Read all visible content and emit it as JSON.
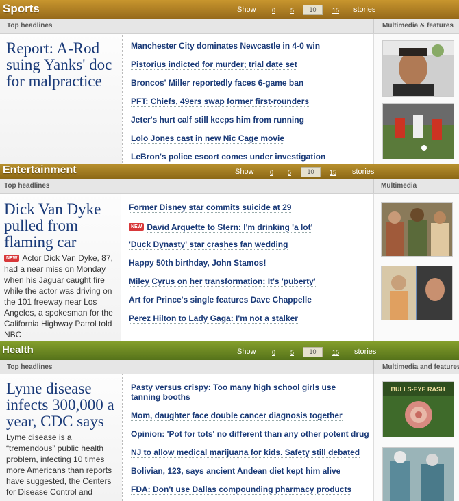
{
  "sports": {
    "title": "Sports",
    "show_label": "Show",
    "counts": [
      "0",
      "5",
      "10",
      "15"
    ],
    "stories_label": "stories",
    "top_headlines": "Top headlines",
    "multimedia": "Multimedia & features",
    "lead": "Report: A-Rod suing Yanks' doc for malpractice",
    "headlines": [
      "Manchester City dominates Newcastle in 4-0 win",
      "Pistorius indicted for murder; trial date set",
      "Broncos' Miller reportedly faces 6-game ban",
      "PFT: Chiefs, 49ers swap former first-rounders",
      "Jeter's hurt calf still keeps him from running",
      "Lolo Jones cast in new Nic Cage movie",
      "LeBron's police escort comes under investigation"
    ]
  },
  "entertainment": {
    "title": "Entertainment",
    "show_label": "Show",
    "counts": [
      "0",
      "5",
      "10",
      "15"
    ],
    "stories_label": "stories",
    "top_headlines": "Top headlines",
    "multimedia": "Multimedia",
    "lead": "Dick Van Dyke pulled from flaming car",
    "new_badge": "NEW",
    "body": "Actor Dick Van Dyke, 87, had a near miss on Monday when his Jaguar caught fire while the actor was driving on the 101 freeway near Los Angeles, a spokesman for the California Highway Patrol told NBC",
    "headlines": [
      "Former Disney star commits suicide at 29",
      "David Arquette to Stern: I'm drinking 'a lot'",
      "'Duck Dynasty' star crashes fan wedding",
      "Happy 50th birthday, John Stamos!",
      "Miley Cyrus on her transformation: It's 'puberty'",
      "Art for Prince's single features Dave Chappelle",
      "Perez Hilton to Lady Gaga: I'm not a stalker"
    ]
  },
  "health": {
    "title": "Health",
    "show_label": "Show",
    "counts": [
      "0",
      "5",
      "10",
      "15"
    ],
    "stories_label": "stories",
    "top_headlines": "Top headlines",
    "multimedia": "Multimedia and features",
    "lead": "Lyme disease infects 300,000 a year, CDC says",
    "body": "Lyme disease is a “tremendous” public health problem, infecting 10 times more Americans than reports have suggested, the Centers for Disease Control and",
    "thumb_caption": "BULLS-EYE RASH",
    "headlines": [
      "Pasty versus crispy: Too many high school girls use tanning booths",
      "Mom, daughter face double cancer diagnosis together",
      "Opinion: 'Pot for tots' no different than any other potent drug",
      "NJ to allow medical marijuana for kids. Safety still debated",
      "Bolivian, 123, says ancient Andean diet kept him alive",
      "FDA: Don't use Dallas compounding pharmacy products"
    ]
  },
  "colors": {
    "sports_bar": "#a8781e",
    "entertainment_bar": "#967218",
    "health_bar": "#6f8a1e",
    "link": "#1a3a78",
    "new_badge": "#d8383a"
  }
}
